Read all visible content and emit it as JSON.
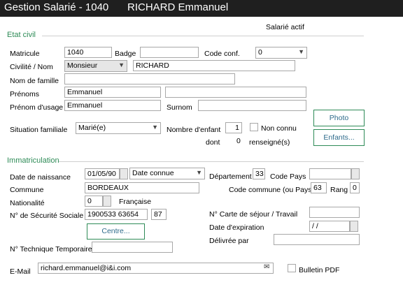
{
  "window": {
    "title": "Gestion Salarié - 1040",
    "employee_name": "RICHARD Emmanuel"
  },
  "status": "Salarié actif",
  "sections": {
    "etat_civil": "Etat civil",
    "immatriculation": "Immatriculation"
  },
  "labels": {
    "matricule": "Matricule",
    "badge": "Badge",
    "code_conf": "Code conf.",
    "civilite_nom": "Civilité /  Nom",
    "nom_famille": "Nom de famille",
    "prenoms": "Prénoms",
    "prenom_usage": "Prénom d'usage",
    "surnom": "Surnom",
    "situation_familiale": "Situation familiale",
    "nombre_enfant": "Nombre d'enfant",
    "non_connu": "Non connu",
    "dont": "dont",
    "renseignes": "renseigné(s)",
    "date_naissance": "Date de naissance",
    "departement": "Département",
    "code_pays": "Code Pays",
    "commune": "Commune",
    "code_commune": "Code commune (ou Pays)",
    "rang": "Rang",
    "nationalite": "Nationalité",
    "nationalite_label": "Française",
    "num_secu": "N° de Sécurité Sociale",
    "carte_sejour": "N° Carte de séjour / Travail",
    "date_expiration": "Date d'expiration",
    "delivree_par": "Délivrée par",
    "num_technique": "N° Technique Temporaire",
    "email": "E-Mail",
    "bulletin_pdf": "Bulletin PDF"
  },
  "values": {
    "matricule": "1040",
    "badge": "",
    "code_conf": "0",
    "civilite": "Monsieur",
    "nom": "RICHARD",
    "nom_famille": "",
    "prenom1": "Emmanuel",
    "prenom2": "",
    "prenom_usage": "Emmanuel",
    "surnom": "",
    "situation_familiale": "Marié(e)",
    "nombre_enfant": "1",
    "dont_count": "0",
    "date_naissance": "01/05/90",
    "date_connue": "Date connue",
    "departement": "33",
    "code_pays": "",
    "commune": "BORDEAUX",
    "code_commune": "63",
    "rang": "0",
    "nationalite_code": "0",
    "num_secu": "1900533 63654",
    "num_secu_cle": "87",
    "carte_sejour": "",
    "date_expiration": "  /  /",
    "delivree_par": "",
    "num_technique": "",
    "email": "richard.emmanuel@i&i.com"
  },
  "buttons": {
    "photo": "Photo",
    "enfants": "Enfants...",
    "centre": "Centre..."
  },
  "colors": {
    "accent": "#2e8b57",
    "titlebar": "#1f1f1f"
  }
}
